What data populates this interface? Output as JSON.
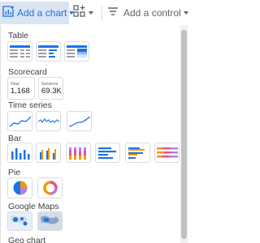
{
  "toolbar": {
    "add_chart_label": "Add a chart",
    "add_chart_icon": "chart-plus-icon",
    "component_icon": "grid-plus-icon",
    "add_control_label": "Add a control",
    "add_control_icon": "filter-lines-icon"
  },
  "colors": {
    "accent": "#1a73e8",
    "highlight": "#dbe4f2",
    "orange": "#f29900",
    "purple": "#b57cde",
    "pink": "#e8508a",
    "text": "#202124"
  },
  "sections": {
    "table": "Table",
    "scorecard": "Scorecard",
    "time_series": "Time series",
    "bar": "Bar",
    "pie": "Pie",
    "google_maps": "Google Maps",
    "geo_chart": "Geo chart"
  },
  "scorecards": [
    {
      "label": "Total",
      "value": "1,168"
    },
    {
      "label": "Sessions",
      "value": "69.3K"
    }
  ]
}
